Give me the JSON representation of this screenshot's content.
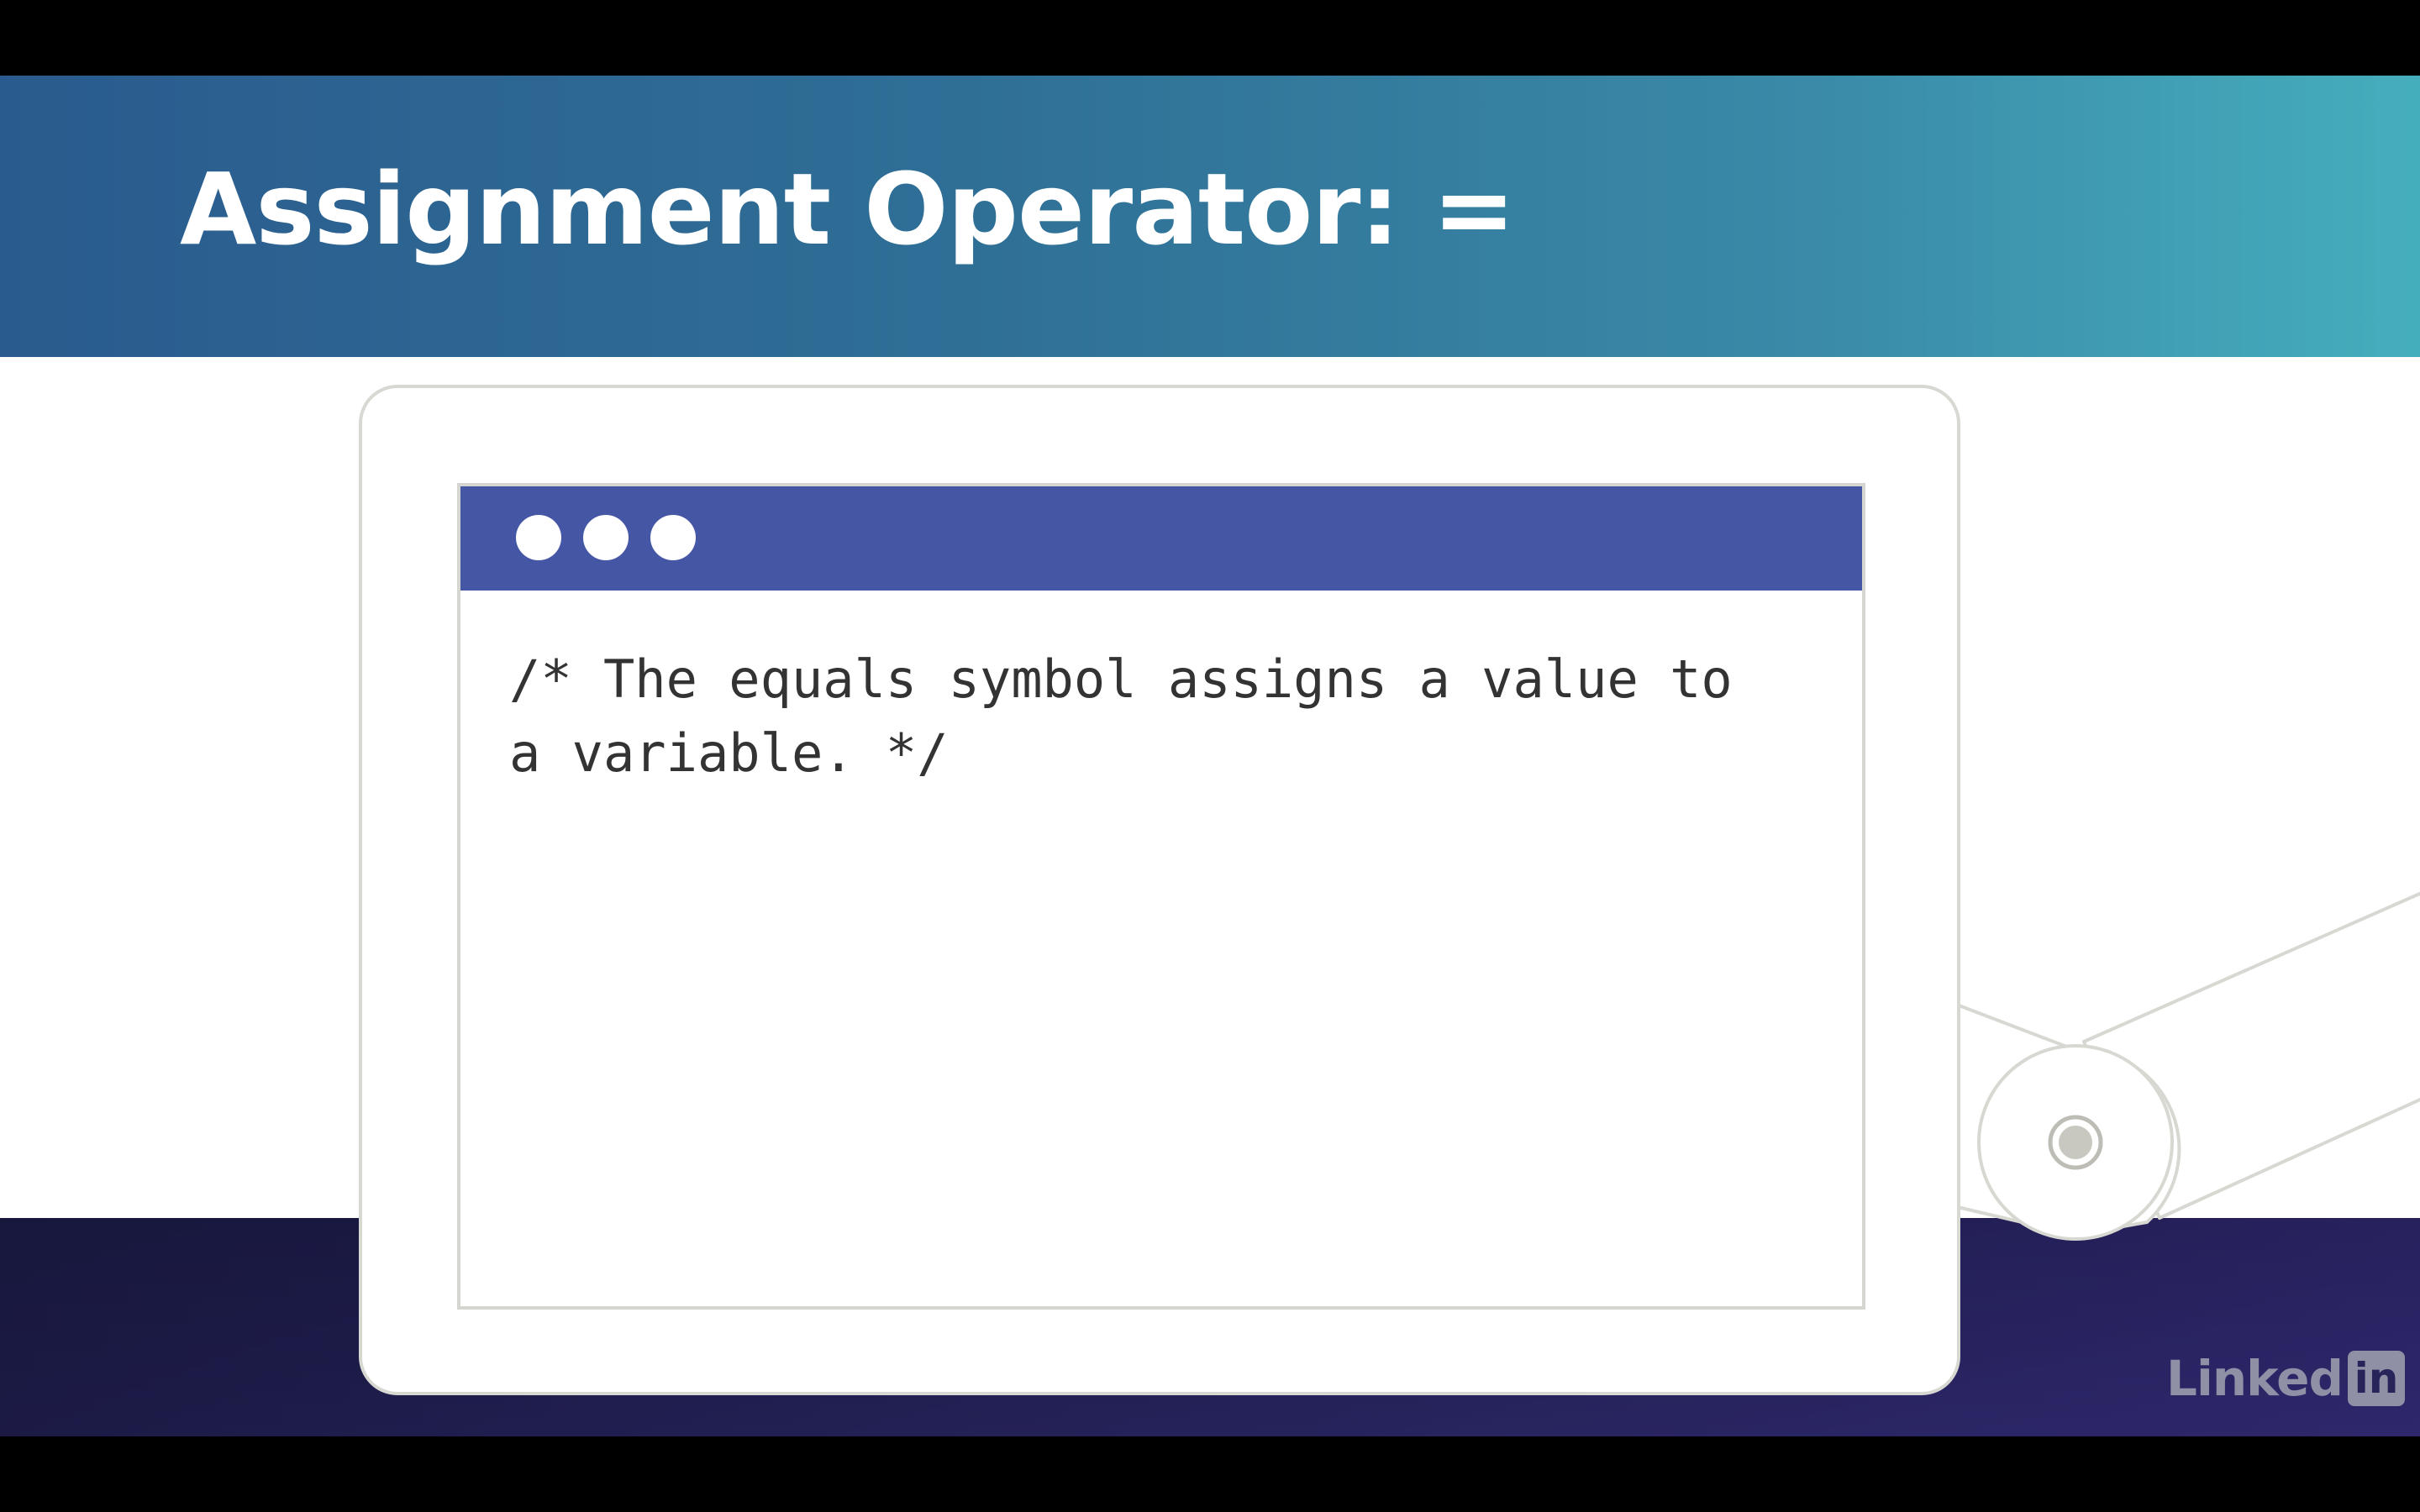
{
  "slide": {
    "title": "Assignment Operator: =",
    "code_window": {
      "lines": [
        "/* The equals symbol assigns a value to",
        "a variable. */"
      ]
    }
  },
  "brand": {
    "text": "Linked",
    "box_text": "in"
  },
  "colors": {
    "banner_start": "#2a5b8e",
    "banner_end": "#45aebd",
    "window_bar": "#4556a4",
    "footer": "#27245a"
  },
  "icons": [
    "window-dot-icon",
    "linkedin-logo-icon"
  ]
}
